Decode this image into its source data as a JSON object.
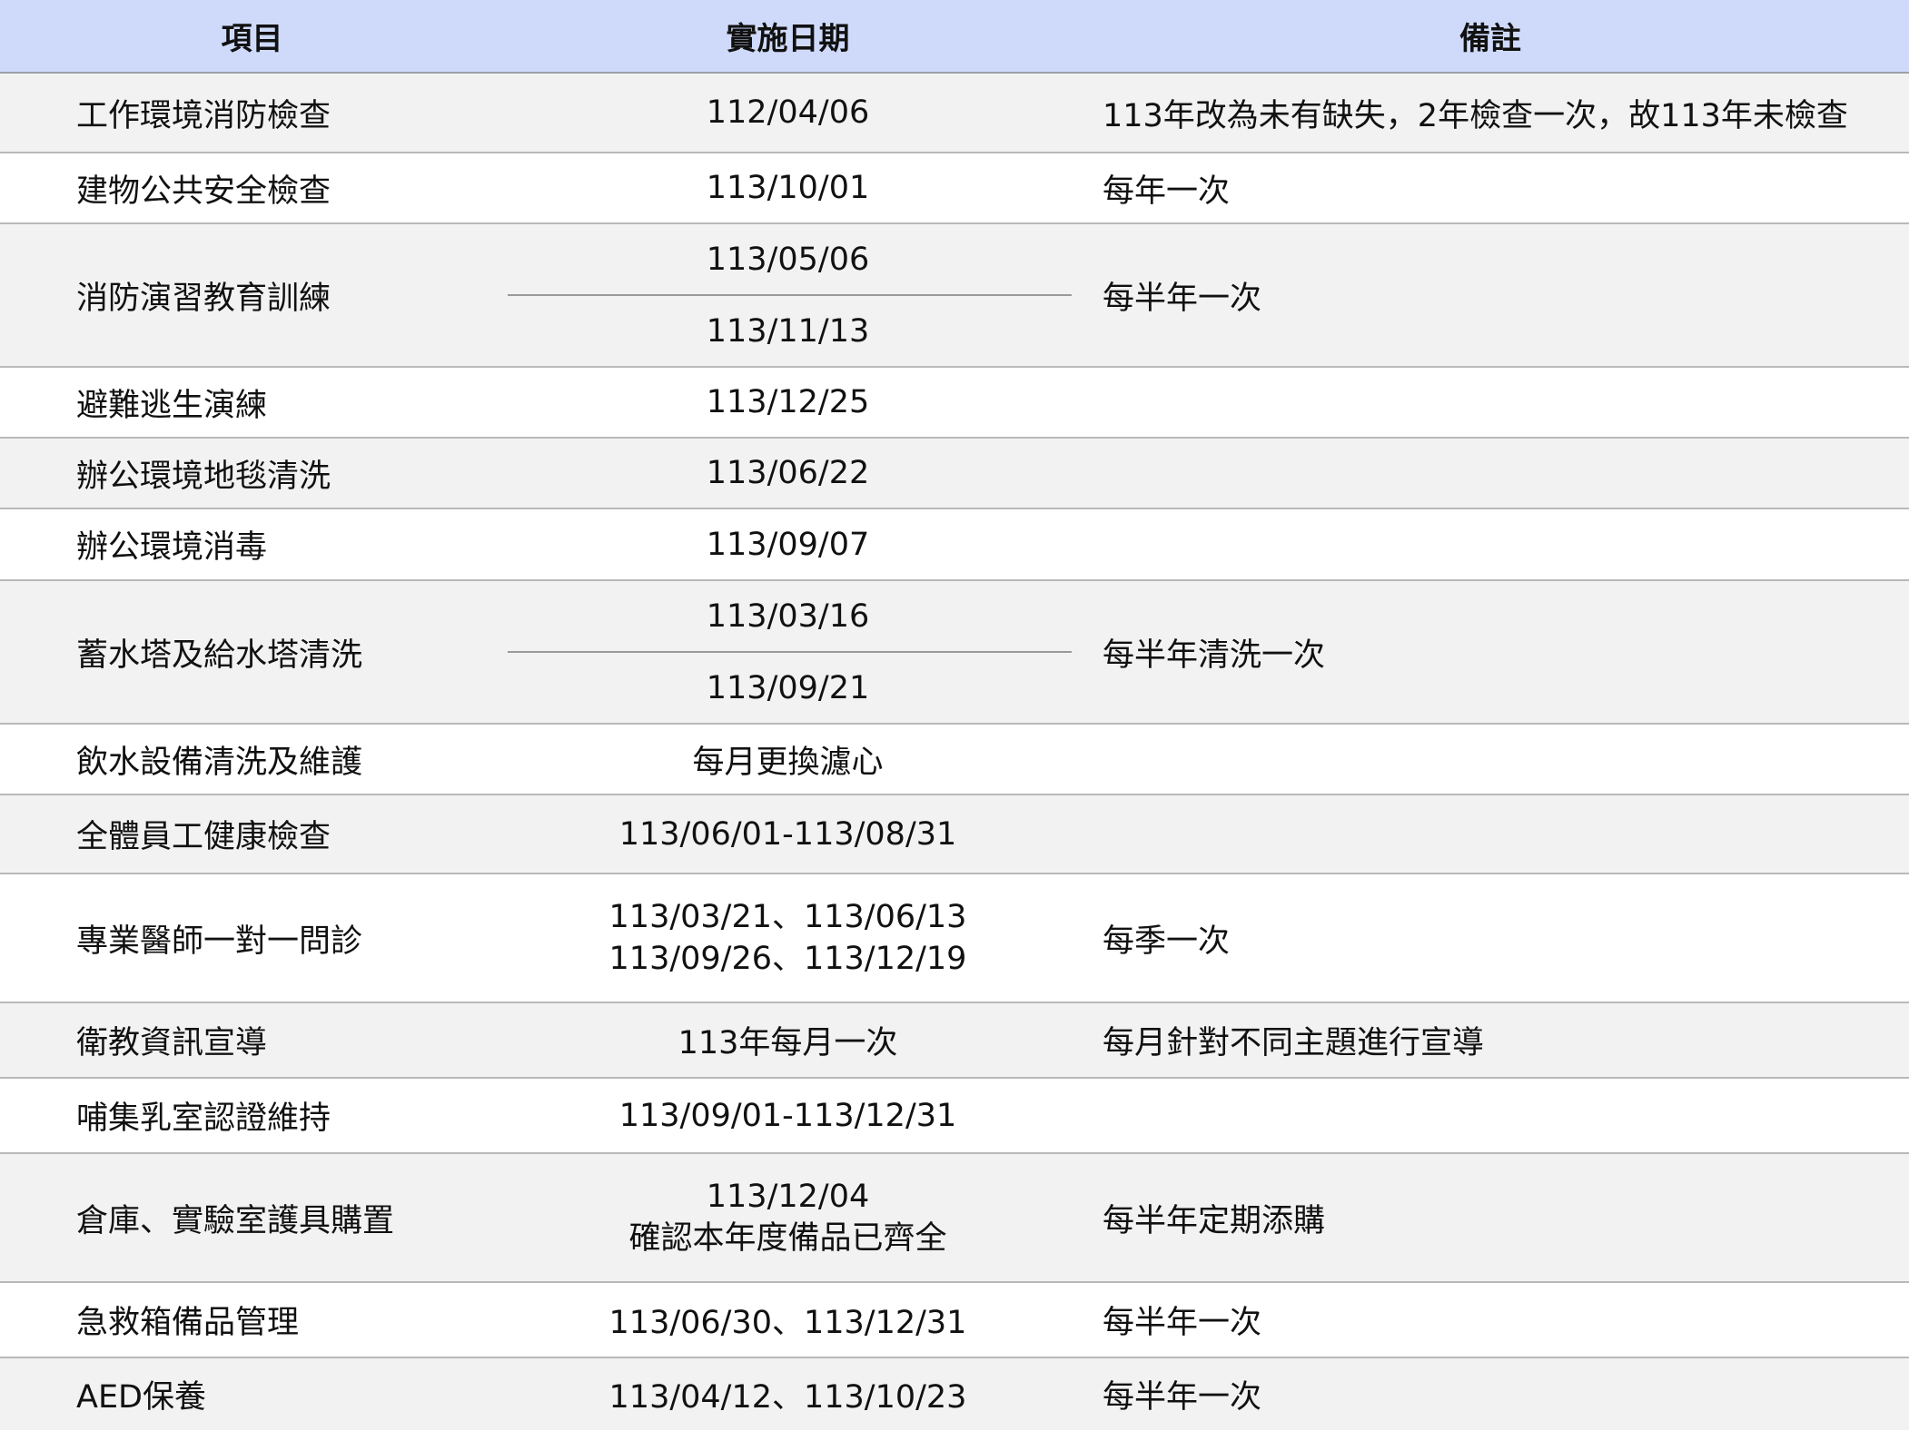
{
  "table": {
    "headers": [
      "項目",
      "實施日期",
      "備註"
    ],
    "rows": [
      {
        "item": "工作環境消防檢查",
        "date": "112/04/06",
        "note": "113年改為未有缺失，2年檢查一次，故113年未檢查"
      },
      {
        "item": "建物公共安全檢查",
        "date": "113/10/01",
        "note": "每年一次"
      },
      {
        "item": "消防演習教育訓練",
        "date_top": "113/05/06",
        "date_bottom": "113/11/13",
        "note": "每半年一次"
      },
      {
        "item": "避難逃生演練",
        "date": "113/12/25",
        "note": ""
      },
      {
        "item": "辦公環境地毯清洗",
        "date": "113/06/22",
        "note": ""
      },
      {
        "item": "辦公環境消毒",
        "date": "113/09/07",
        "note": ""
      },
      {
        "item": "蓄水塔及給水塔清洗",
        "date_top": "113/03/16",
        "date_bottom": "113/09/21",
        "note": "每半年清洗一次"
      },
      {
        "item": "飲水設備清洗及維護",
        "date": "每月更換濾心",
        "note": ""
      },
      {
        "item": "全體員工健康檢查",
        "date": "113/06/01-113/08/31",
        "note": ""
      },
      {
        "item": "專業醫師一對一問診",
        "date_line1": "113/03/21、113/06/13",
        "date_line2": "113/09/26、113/12/19",
        "note": "每季一次"
      },
      {
        "item": "衛教資訊宣導",
        "date": "113年每月一次",
        "note": "每月針對不同主題進行宣導"
      },
      {
        "item": "哺集乳室認證維持",
        "date": "113/09/01-113/12/31",
        "note": ""
      },
      {
        "item": "倉庫、實驗室護具購置",
        "date_line1": "113/12/04",
        "date_line2": "確認本年度備品已齊全",
        "note": "每半年定期添購"
      },
      {
        "item": "急救箱備品管理",
        "date": "113/06/30、113/12/31",
        "note": "每半年一次"
      },
      {
        "item": "AED保養",
        "date": "113/04/12、113/10/23",
        "note": "每半年一次"
      }
    ]
  }
}
